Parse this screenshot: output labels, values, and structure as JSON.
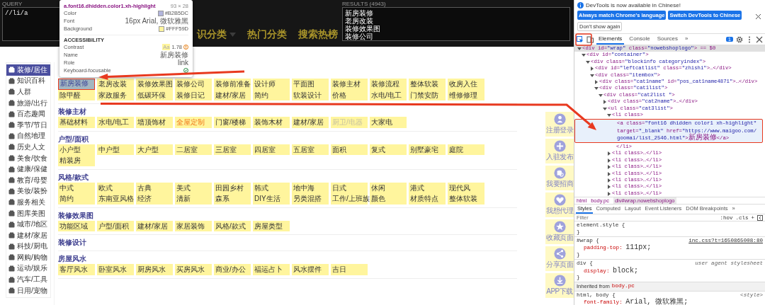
{
  "inspector_overlay": {
    "query": {
      "label": "QUERY",
      "value": "//li/a"
    },
    "results": {
      "label": "RESULTS (4943)",
      "items": [
        "新房装修",
        "老房改装",
        "装修效果图",
        "装修公司"
      ]
    }
  },
  "site_nav": [
    "识分类",
    "热门分类",
    "搜索热榜"
  ],
  "tooltip": {
    "selector": "a.font16.dhidden.color1.xh-highlight",
    "size": "93 × 28",
    "rows": [
      {
        "label": "Color",
        "value": "#B2B5DC",
        "color": "#b2b5dc"
      },
      {
        "label": "Font",
        "value": "16px Arial, 微软雅黑"
      },
      {
        "label": "Background",
        "value": "#FFF59D",
        "color": "#fff59d"
      }
    ],
    "section": "ACCESSIBILITY",
    "a11y": [
      {
        "label": "Contrast",
        "kind": "contrast",
        "badge": "Aa",
        "value": "1.78"
      },
      {
        "label": "Name",
        "kind": "text",
        "value": "新房装修"
      },
      {
        "label": "Role",
        "kind": "text",
        "value": "link"
      },
      {
        "label": "Keyboard-focusable",
        "kind": "check"
      }
    ]
  },
  "sidebar": [
    {
      "label": "装修/居住",
      "selected": true
    },
    {
      "label": "知识百科",
      "selected": false
    },
    {
      "label": "人群",
      "selected": false
    },
    {
      "label": "旅游/出行",
      "selected": false
    },
    {
      "label": "百态趣闻",
      "selected": false
    },
    {
      "label": "季节/节日",
      "selected": false
    },
    {
      "label": "自然地理",
      "selected": false
    },
    {
      "label": "历史人文",
      "selected": false
    },
    {
      "label": "美食/饮食",
      "selected": false
    },
    {
      "label": "健康/保健",
      "selected": false
    },
    {
      "label": "教育/母婴",
      "selected": false
    },
    {
      "label": "美妆/装扮",
      "selected": false
    },
    {
      "label": "服务相关",
      "selected": false
    },
    {
      "label": "图库美图",
      "selected": false
    },
    {
      "label": "城市/地区",
      "selected": false
    },
    {
      "label": "建材/家居",
      "selected": false
    },
    {
      "label": "科技/厨电",
      "selected": false
    },
    {
      "label": "网购/购物",
      "selected": false
    },
    {
      "label": "运动/娱乐",
      "selected": false
    },
    {
      "label": "汽车/工具",
      "selected": false
    },
    {
      "label": "日用/宠物",
      "selected": false
    }
  ],
  "sections": [
    {
      "items": [
        {
          "label": "新房装修",
          "kind": "inspected"
        },
        {
          "label": "老房改装",
          "kind": "plain"
        },
        {
          "label": "装修效果图",
          "kind": "plain"
        },
        {
          "label": "装修公司",
          "kind": "plain"
        },
        {
          "label": "装修前准备",
          "kind": "plain"
        },
        {
          "label": "设计师",
          "kind": "plain"
        },
        {
          "label": "平面图",
          "kind": "plain"
        },
        {
          "label": "装修主材",
          "kind": "plain"
        },
        {
          "label": "装修流程",
          "kind": "plain"
        },
        {
          "label": "整体软装",
          "kind": "plain"
        },
        {
          "label": "收房入住",
          "kind": "plain"
        },
        {
          "label": "除甲醛",
          "kind": "plain"
        },
        {
          "label": "家政服务",
          "kind": "plain"
        },
        {
          "label": "低碳环保",
          "kind": "plain"
        },
        {
          "label": "装修日记",
          "kind": "plain"
        },
        {
          "label": "建材/家居",
          "kind": "plain"
        },
        {
          "label": "简约",
          "kind": "plain"
        },
        {
          "label": "软装设计",
          "kind": "plain"
        },
        {
          "label": "价格",
          "kind": "plain"
        },
        {
          "label": "水电/电工",
          "kind": "plain"
        },
        {
          "label": "门禁安防",
          "kind": "plain"
        },
        {
          "label": "维修修理",
          "kind": "plain"
        }
      ]
    },
    {
      "title": "装修主材",
      "items": [
        {
          "label": "基础材料",
          "kind": "plain"
        },
        {
          "label": "水电/电工",
          "kind": "plain"
        },
        {
          "label": "墙顶饰材",
          "kind": "plain"
        },
        {
          "label": "全屋定制",
          "kind": "hot"
        },
        {
          "label": "门窗/楼梯",
          "kind": "plain"
        },
        {
          "label": "装饰木材",
          "kind": "plain"
        },
        {
          "label": "建材/家居",
          "kind": "plain"
        },
        {
          "label": "厨卫/电器",
          "kind": "faded"
        },
        {
          "label": "大家电",
          "kind": "plain"
        }
      ]
    },
    {
      "title": "户型/面积",
      "items": [
        {
          "label": "小户型",
          "kind": "plain"
        },
        {
          "label": "中户型",
          "kind": "plain"
        },
        {
          "label": "大户型",
          "kind": "plain"
        },
        {
          "label": "二居室",
          "kind": "plain"
        },
        {
          "label": "三居室",
          "kind": "plain"
        },
        {
          "label": "四居室",
          "kind": "plain"
        },
        {
          "label": "五居室",
          "kind": "plain"
        },
        {
          "label": "面积",
          "kind": "plain"
        },
        {
          "label": "复式",
          "kind": "plain"
        },
        {
          "label": "别墅豪宅",
          "kind": "plain"
        },
        {
          "label": "庭院",
          "kind": "plain"
        },
        {
          "label": "精装房",
          "kind": "plain"
        }
      ]
    },
    {
      "title": "风格/款式",
      "items": [
        {
          "label": "中式",
          "kind": "plain"
        },
        {
          "label": "欧式",
          "kind": "plain"
        },
        {
          "label": "古典",
          "kind": "plain"
        },
        {
          "label": "美式",
          "kind": "plain"
        },
        {
          "label": "田园乡村",
          "kind": "plain"
        },
        {
          "label": "韩式",
          "kind": "plain"
        },
        {
          "label": "地中海",
          "kind": "plain"
        },
        {
          "label": "日式",
          "kind": "plain"
        },
        {
          "label": "休闲",
          "kind": "plain"
        },
        {
          "label": "港式",
          "kind": "plain"
        },
        {
          "label": "现代风",
          "kind": "plain"
        },
        {
          "label": "简约",
          "kind": "plain"
        },
        {
          "label": "东南亚风格",
          "kind": "plain"
        },
        {
          "label": "经济",
          "kind": "plain"
        },
        {
          "label": "清新",
          "kind": "plain"
        },
        {
          "label": "森系",
          "kind": "plain"
        },
        {
          "label": "DIY生活",
          "kind": "plain"
        },
        {
          "label": "另类混搭",
          "kind": "plain"
        },
        {
          "label": "工作/上班族",
          "kind": "plain"
        },
        {
          "label": "颜色",
          "kind": "plain"
        },
        {
          "label": "材质特点",
          "kind": "plain"
        },
        {
          "label": "整体软装",
          "kind": "plain"
        }
      ]
    },
    {
      "title": "装修效果图",
      "items": [
        {
          "label": "功能区域",
          "kind": "plain"
        },
        {
          "label": "户型/面积",
          "kind": "plain"
        },
        {
          "label": "建材/家居",
          "kind": "plain"
        },
        {
          "label": "家居装饰",
          "kind": "plain"
        },
        {
          "label": "风格/款式",
          "kind": "plain"
        },
        {
          "label": "房屋类型",
          "kind": "plain"
        }
      ]
    },
    {
      "title": "装修设计"
    },
    {
      "title": "房屋风水",
      "items": [
        {
          "label": "客厅风水",
          "kind": "plain"
        },
        {
          "label": "卧室风水",
          "kind": "plain"
        },
        {
          "label": "厨房风水",
          "kind": "plain"
        },
        {
          "label": "买房风水",
          "kind": "plain"
        },
        {
          "label": "商业/办公",
          "kind": "plain"
        },
        {
          "label": "福运占卜",
          "kind": "plain"
        },
        {
          "label": "风水摆件",
          "kind": "plain"
        },
        {
          "label": "吉日",
          "kind": "plain"
        }
      ]
    }
  ],
  "float_bar": [
    {
      "label": "注册登录",
      "kind": "person"
    },
    {
      "label": "入驻发布",
      "kind": "plus"
    },
    {
      "label": "我要招商",
      "kind": "coins"
    },
    {
      "label": "我想代理",
      "kind": "heart"
    },
    {
      "label": "收藏页面",
      "kind": "star"
    },
    {
      "label": "分享页面",
      "kind": "share"
    },
    {
      "label": "APP下载",
      "kind": "download"
    }
  ],
  "devtools": {
    "banner": {
      "message": "DevTools is now available in Chinese!",
      "buttons": [
        "Always match Chrome's language",
        "Switch DevTools to Chinese"
      ],
      "dismiss": "Don't show again"
    },
    "tabs": [
      {
        "label": "Elements",
        "selected": true
      },
      {
        "label": "Console",
        "selected": false
      },
      {
        "label": "Sources",
        "selected": false
      }
    ],
    "tabs_more": "»",
    "issues": "1",
    "dom": [
      {
        "markup": "<div id=\"wrap\" class=\"nowebshoplogo\"> == $0",
        "kind": "node",
        "expanded": true,
        "selected": true,
        "children": [
          {
            "markup": "<div id=\"container\">",
            "kind": "node",
            "expanded": true,
            "children": [
              {
                "markup": "<div class=\"blockinfo categoryindex\">",
                "kind": "node",
                "expanded": true,
                "children": [
                  {
                    "markup": "<div id=\"leftcatlist\" class=\"zhishi\">…</div>",
                    "kind": "node",
                    "expanded": false
                  },
                  {
                    "markup": "<div class=\"itembox\">",
                    "kind": "node",
                    "expanded": true,
                    "children": [
                      {
                        "markup": "<div class=\"cat1name\" id=\"pos_cat1name4871\">…</div>",
                        "kind": "node",
                        "expanded": false
                      },
                      {
                        "markup": "<div class=\"cat1list\">",
                        "kind": "node",
                        "expanded": true,
                        "children": [
                          {
                            "markup": "<div class=\"cat2list \">",
                            "kind": "node",
                            "expanded": true,
                            "children": [
                              {
                                "markup": "<div class=\"cat2name\">…</div>",
                                "kind": "node",
                                "expanded": false
                              },
                              {
                                "markup": "<ul class=\"cat3list\">",
                                "kind": "node",
                                "expanded": true,
                                "children": [
                                  {
                                    "markup": "<li class>",
                                    "kind": "node",
                                    "expanded": true,
                                    "children": [
                                      {
                                        "markup": "<a class=\"font16 dhidden color1 xh-highlight\" target=\"_blank\" href=\"https://www.maigoo.com/goomai/list_2546.html\">新房装修</a>",
                                        "kind": "leaf",
                                        "hovered": true
                                      },
                                      {
                                        "markup": "</li>",
                                        "kind": "leaf"
                                      }
                                    ]
                                  },
                                  {
                                    "markup": "<li class>…</li>",
                                    "kind": "node",
                                    "expanded": false
                                  },
                                  {
                                    "markup": "<li class>…</li>",
                                    "kind": "node",
                                    "expanded": false
                                  },
                                  {
                                    "markup": "<li class>…</li>",
                                    "kind": "node",
                                    "expanded": false
                                  },
                                  {
                                    "markup": "<li class>…</li>",
                                    "kind": "node",
                                    "expanded": false
                                  },
                                  {
                                    "markup": "<li class>…</li>",
                                    "kind": "node",
                                    "expanded": false
                                  },
                                  {
                                    "markup": "<li class>…</li>",
                                    "kind": "node",
                                    "expanded": false
                                  },
                                  {
                                    "markup": "<li class>…</li>",
                                    "kind": "node",
                                    "expanded": false
                                  }
                                ]
                              }
                            ]
                          }
                        ]
                      }
                    ]
                  }
                ]
              }
            ]
          }
        ]
      }
    ],
    "breadcrumb": [
      {
        "label": "html",
        "selected": false
      },
      {
        "label": "body.pc",
        "selected": false
      },
      {
        "label": "div#wrap.nowebshoplogo",
        "selected": true
      }
    ],
    "style_tabs": [
      {
        "label": "Styles",
        "selected": true
      },
      {
        "label": "Computed",
        "selected": false
      },
      {
        "label": "Layout",
        "selected": false
      },
      {
        "label": "Event Listeners",
        "selected": false
      },
      {
        "label": "DOM Breakpoints",
        "selected": false
      }
    ],
    "style_tabs_more": "»",
    "filter": {
      "placeholder": "Filter"
    },
    "filter_tools": [
      ":hov",
      ".cls",
      "+"
    ],
    "rules": [
      {
        "selector": "element.style {",
        "close": "}"
      },
      {
        "selector": "#wrap {",
        "source": "inc.css?t=1650865008:80",
        "kind": "link",
        "declarations": [
          {
            "property": "padding-top:",
            "value": "111px;"
          }
        ],
        "close": "}"
      },
      {
        "selector": "div {",
        "source": "user agent stylesheet",
        "kind": "note",
        "declarations": [
          {
            "property": "display:",
            "value": "block;"
          }
        ],
        "close": "}"
      }
    ],
    "inherited": {
      "label": "Inherited from",
      "from": "body.pc"
    },
    "inherited_rules": [
      {
        "selector": "html, body {",
        "source": "<style>",
        "kind": "note",
        "declarations": [
          {
            "property": "font-family:",
            "value": "Arial, 微软雅黑;"
          }
        ]
      }
    ]
  }
}
